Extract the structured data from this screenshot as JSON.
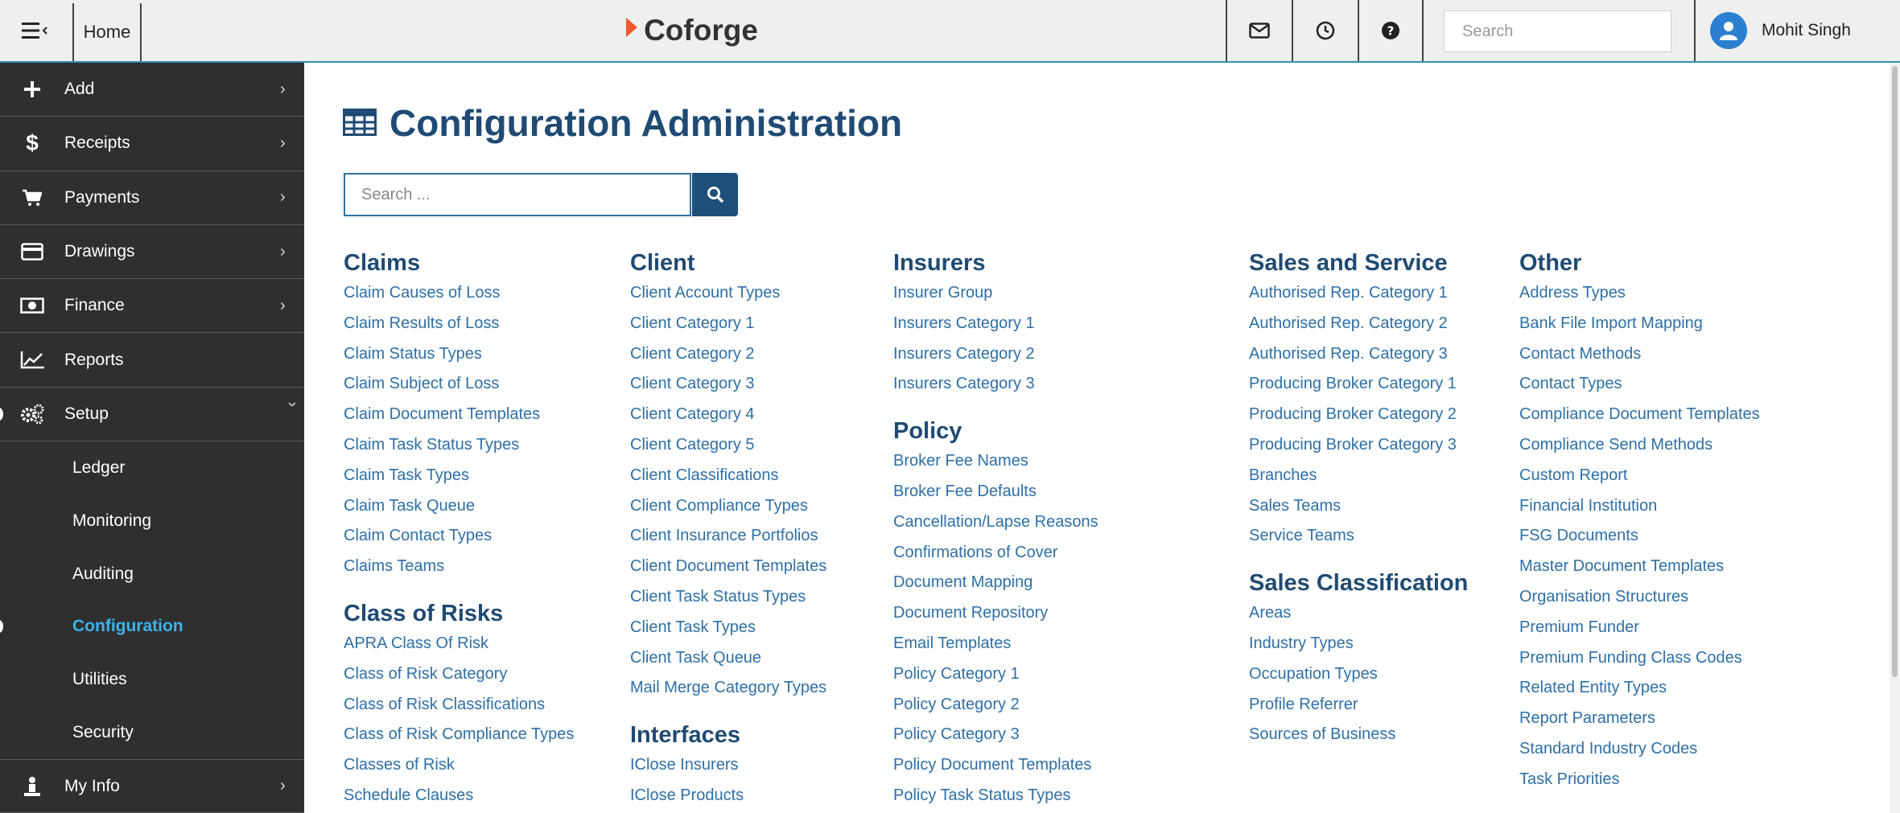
{
  "topbar": {
    "home_label": "Home",
    "brand": "Coforge",
    "search_placeholder": "Search",
    "user_name": "Mohit Singh"
  },
  "sidebar": {
    "items": [
      {
        "label": "Add",
        "icon": "plus-icon"
      },
      {
        "label": "Receipts",
        "icon": "dollar-icon"
      },
      {
        "label": "Payments",
        "icon": "cart-icon"
      },
      {
        "label": "Drawings",
        "icon": "credit-card-icon"
      },
      {
        "label": "Finance",
        "icon": "money-icon"
      },
      {
        "label": "Reports",
        "icon": "line-chart-icon"
      },
      {
        "label": "Setup",
        "icon": "gears-icon"
      }
    ],
    "setup_sub": [
      "Ledger",
      "Monitoring",
      "Auditing",
      "Configuration",
      "Utilities",
      "Security"
    ],
    "active_sub": "Configuration",
    "myinfo_label": "My Info"
  },
  "main": {
    "title": "Configuration Administration",
    "search_placeholder": "Search ...",
    "colors": {
      "title": "#1f4a73",
      "link": "#2e6fa6",
      "accent_blue": "#3cb3ee"
    },
    "columns": [
      {
        "sections": [
          {
            "title": "Claims",
            "links": [
              "Claim Causes of Loss",
              "Claim Results of Loss",
              "Claim Status Types",
              "Claim Subject of Loss",
              "Claim Document Templates",
              "Claim Task Status Types",
              "Claim Task Types",
              "Claim Task Queue",
              "Claim Contact Types",
              "Claims Teams"
            ]
          },
          {
            "title": "Class of Risks",
            "links": [
              "APRA Class Of Risk",
              "Class of Risk Category",
              "Class of Risk Classifications",
              "Class of Risk Compliance Types",
              "Classes of Risk",
              "Schedule Clauses"
            ]
          }
        ]
      },
      {
        "sections": [
          {
            "title": "Client",
            "links": [
              "Client Account Types",
              "Client Category 1",
              "Client Category 2",
              "Client Category 3",
              "Client Category 4",
              "Client Category 5",
              "Client Classifications",
              "Client Compliance Types",
              "Client Insurance Portfolios",
              "Client Document Templates",
              "Client Task Status Types",
              "Client Task Types",
              "Client Task Queue",
              "Mail Merge Category Types"
            ]
          },
          {
            "title": "Interfaces",
            "links": [
              "IClose Insurers",
              "IClose Products"
            ]
          }
        ]
      },
      {
        "sections": [
          {
            "title": "Insurers",
            "links": [
              "Insurer Group",
              "Insurers Category 1",
              "Insurers Category 2",
              "Insurers Category 3"
            ]
          },
          {
            "title": "Policy",
            "links": [
              "Broker Fee Names",
              "Broker Fee Defaults",
              "Cancellation/Lapse Reasons",
              "Confirmations of Cover",
              "Document Mapping",
              "Document Repository",
              "Email Templates",
              "Policy Category 1",
              "Policy Category 2",
              "Policy Category 3",
              "Policy Document Templates",
              "Policy Task Status Types"
            ]
          }
        ]
      },
      {
        "sections": [
          {
            "title": "Sales and Service",
            "links": [
              "Authorised Rep. Category 1",
              "Authorised Rep. Category 2",
              "Authorised Rep. Category 3",
              "Producing Broker Category 1",
              "Producing Broker Category 2",
              "Producing Broker Category 3",
              "Branches",
              "Sales Teams",
              "Service Teams"
            ]
          },
          {
            "title": "Sales Classification",
            "links": [
              "Areas",
              "Industry Types",
              "Occupation Types",
              "Profile Referrer",
              "Sources of Business"
            ]
          }
        ]
      },
      {
        "sections": [
          {
            "title": "Other",
            "links": [
              "Address Types",
              "Bank File Import Mapping",
              "Contact Methods",
              "Contact Types",
              "Compliance Document Templates",
              "Compliance Send Methods",
              "Custom Report",
              "Financial Institution",
              "FSG Documents",
              "Master Document Templates",
              "Organisation Structures",
              "Premium Funder",
              "Premium Funding Class Codes",
              "Related Entity Types",
              "Report Parameters",
              "Standard Industry Codes",
              "Task Priorities"
            ]
          }
        ]
      }
    ]
  }
}
